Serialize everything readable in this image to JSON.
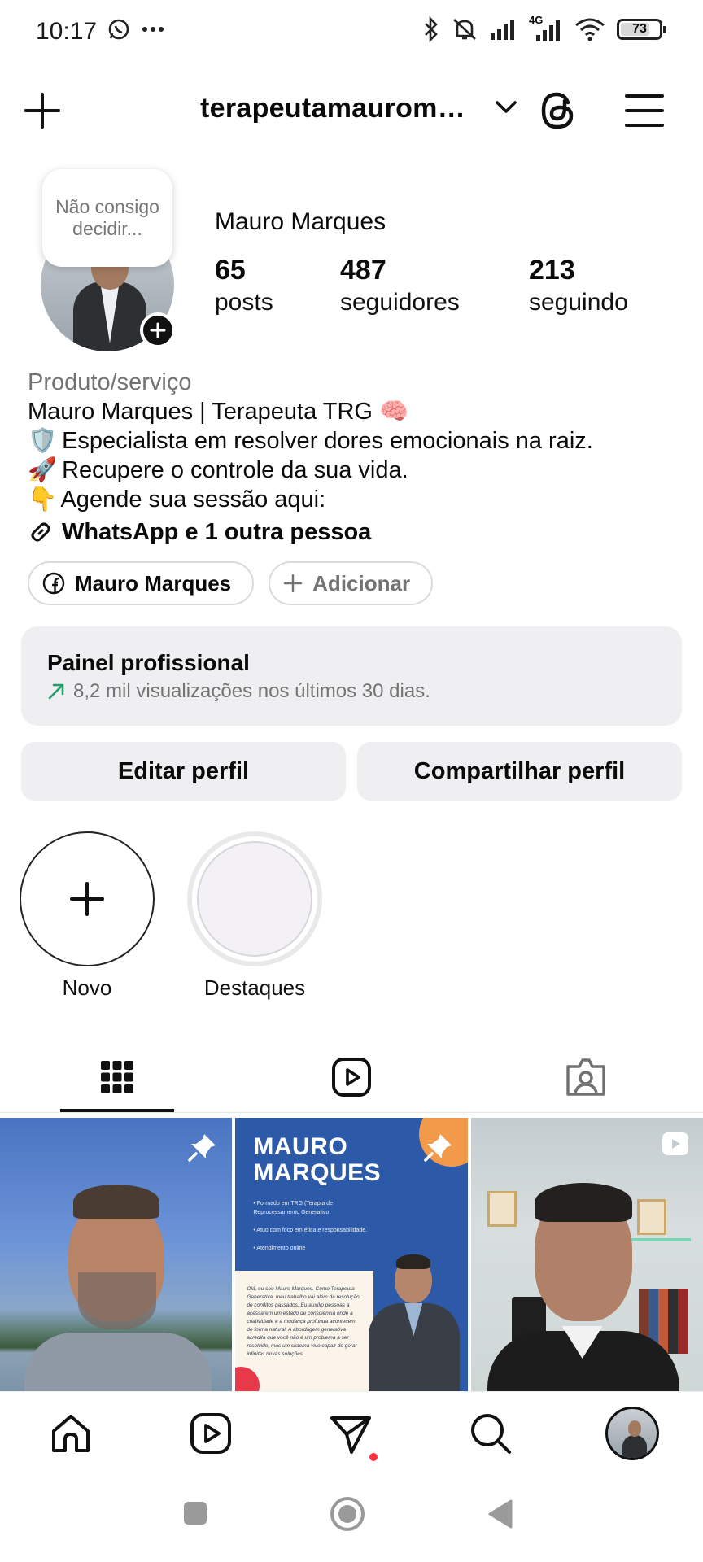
{
  "status_bar": {
    "time": "10:17",
    "battery": "73",
    "network": "4G",
    "icons": [
      "whatsapp-icon",
      "more-dots-icon",
      "bluetooth-icon",
      "silent-icon",
      "signal-icon",
      "signal-4g-icon",
      "wifi-icon",
      "battery-icon"
    ]
  },
  "header": {
    "username": "terapeutamauromarques",
    "icons": [
      "plus-icon",
      "chevron-down-icon",
      "threads-icon",
      "menu-icon"
    ]
  },
  "profile": {
    "note": "Não consigo decidir...",
    "full_name": "Mauro Marques",
    "stats": [
      {
        "value": "65",
        "label": "posts"
      },
      {
        "value": "487",
        "label": "seguidores"
      },
      {
        "value": "213",
        "label": "seguindo"
      }
    ],
    "category": "Produto/serviço",
    "bio": [
      {
        "emoji": "",
        "text": "Mauro Marques | Terapeuta TRG 🧠"
      },
      {
        "emoji": "🛡️",
        "text": "Especialista em resolver dores emocionais na raiz."
      },
      {
        "emoji": "🚀",
        "text": "Recupere o controle da sua vida."
      },
      {
        "emoji": "👇",
        "text": "Agende sua sessão aqui:"
      }
    ],
    "link_text": "WhatsApp e 1 outra pessoa",
    "chips": {
      "facebook_label": "Mauro Marques",
      "add_label": "Adicionar"
    }
  },
  "pro_panel": {
    "title": "Painel profissional",
    "subtitle": "8,2 mil visualizações nos últimos 30 dias."
  },
  "buttons": {
    "edit": "Editar perfil",
    "share": "Compartilhar perfil"
  },
  "highlights": [
    {
      "label": "Novo"
    },
    {
      "label": "Destaques"
    }
  ],
  "tabs": [
    "posts-grid-icon",
    "reels-icon",
    "tagged-icon"
  ],
  "posts": {
    "poster_title_1": "MAURO",
    "poster_title_2": "MARQUES",
    "poster_items": [
      "Formado em TRG (Terapia de Reprocessamento Generativo.",
      "Atuo com foco em ética e responsabilidade.",
      "Atendimento online"
    ],
    "poster_text": "Olá, eu sou Mauro Marques. Como Terapeuta Generativa, meu trabalho vai além da resolução de conflitos passados. Eu auxílio pessoas a acessarem um estado de consciência onde a criatividade e a mudança profunda acontecem de forma natural. A abordagem generativa acredita que você não é um problema a ser resolvido, mas um sistema vivo capaz de gerar infinitas novas soluções."
  },
  "bottom_nav": [
    "home-icon",
    "reels-icon",
    "direct-icon",
    "search-icon",
    "profile-avatar"
  ],
  "colors": {
    "accent_red": "#ff3040",
    "panel_gray": "#efeff1",
    "muted_text": "#737373",
    "trend_green": "#1e9e6a"
  }
}
